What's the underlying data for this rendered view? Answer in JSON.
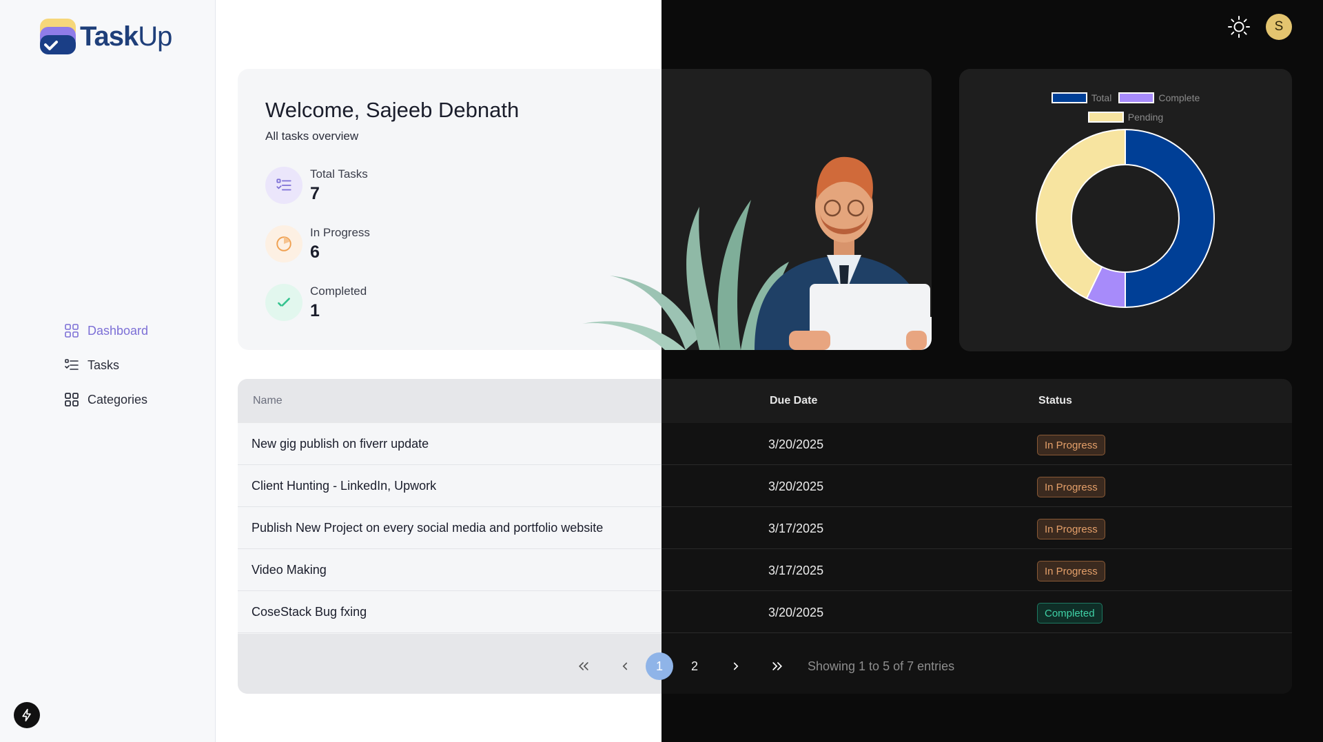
{
  "app": {
    "name_bold": "Task",
    "name_light": "Up"
  },
  "sidebar": {
    "items": [
      {
        "label": "Dashboard",
        "icon": "dashboard-icon",
        "active": true
      },
      {
        "label": "Tasks",
        "icon": "tasks-icon",
        "active": false
      },
      {
        "label": "Categories",
        "icon": "categories-icon",
        "active": false
      }
    ]
  },
  "header": {
    "avatar_initial": "S",
    "theme_icon": "sun-icon"
  },
  "welcome": {
    "title": "Welcome, Sajeeb Debnath",
    "subtitle": "All tasks overview",
    "stats": [
      {
        "label": "Total Tasks",
        "value": "7",
        "icon": "tasks-list-icon",
        "color": "#7c6fd6"
      },
      {
        "label": "In Progress",
        "value": "6",
        "icon": "clock-progress-icon",
        "color": "#f0a050"
      },
      {
        "label": "Completed",
        "value": "1",
        "icon": "check-icon",
        "color": "#34c38f"
      }
    ]
  },
  "chart_data": {
    "type": "pie",
    "legend": [
      "Total",
      "Complete",
      "Pending"
    ],
    "colors": [
      "#003f96",
      "#a78bfa",
      "#f7e4a0"
    ],
    "values": [
      7,
      1,
      6
    ],
    "legend_position": "top"
  },
  "table": {
    "headers": {
      "name": "Name",
      "due": "Due Date",
      "status": "Status"
    },
    "rows": [
      {
        "name": "New gig publish on fiverr update",
        "due": "3/20/2025",
        "status": "In Progress"
      },
      {
        "name": "Client Hunting - LinkedIn, Upwork",
        "due": "3/20/2025",
        "status": "In Progress"
      },
      {
        "name": "Publish New Project on every social media and portfolio website",
        "due": "3/17/2025",
        "status": "In Progress"
      },
      {
        "name": "Video Making",
        "due": "3/17/2025",
        "status": "In Progress"
      },
      {
        "name": "CoseStack Bug fxing",
        "due": "3/20/2025",
        "status": "Completed"
      }
    ]
  },
  "pagination": {
    "pages": [
      "1",
      "2"
    ],
    "current": "1",
    "showing": "Showing 1 to 5 of 7 entries"
  }
}
